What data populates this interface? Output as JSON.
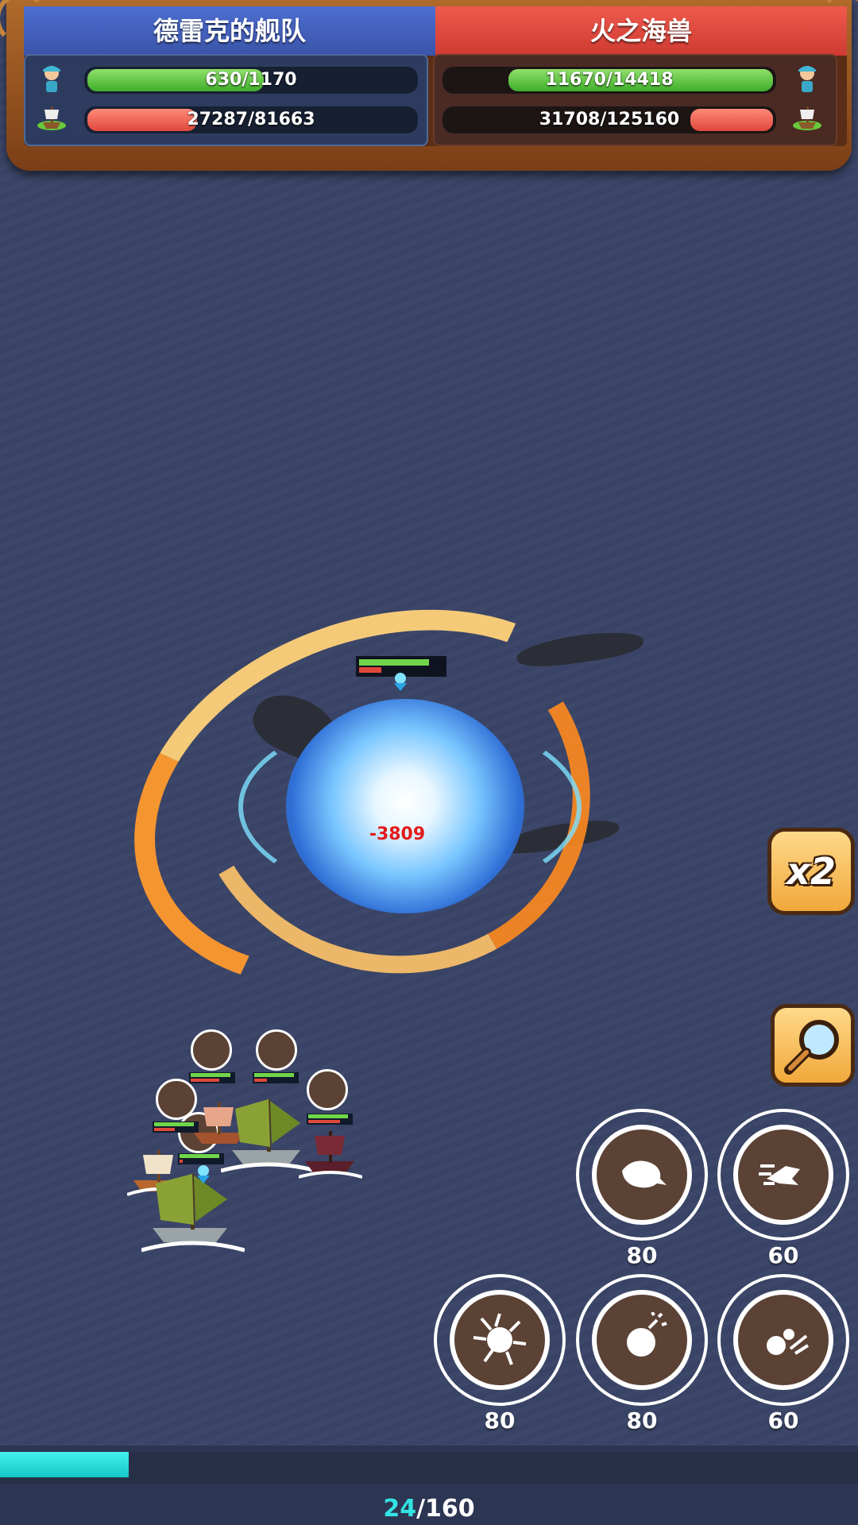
{
  "header": {
    "left_team": {
      "name": "德雷克的舰队",
      "crew": {
        "text": "630/1170",
        "current": 630,
        "max": 1170
      },
      "ships": {
        "text": "27287/81663",
        "current": 27287,
        "max": 81663
      }
    },
    "right_team": {
      "name": "火之海兽",
      "crew": {
        "text": "11670/14418",
        "current": 11670,
        "max": 14418
      },
      "ships": {
        "text": "31708/125160",
        "current": 31708,
        "max": 125160
      }
    }
  },
  "battle": {
    "damage_text": "-3809"
  },
  "controls": {
    "speed_label": "x2",
    "zoom_icon": "magnifier-icon"
  },
  "skills": [
    {
      "icon": "whale-skill-icon",
      "cost": "80"
    },
    {
      "icon": "dash-skill-icon",
      "cost": "60"
    },
    {
      "icon": "lightning-orb-skill-icon",
      "cost": "80"
    },
    {
      "icon": "bomb-skill-icon",
      "cost": "80"
    },
    {
      "icon": "cannonball-skill-icon",
      "cost": "60"
    }
  ],
  "progress": {
    "current": "24",
    "separator": "/",
    "max": "160",
    "fraction": 0.15
  },
  "colors": {
    "left_team": "#4263c0",
    "right_team": "#e0483c",
    "accent": "#33e3e3"
  }
}
